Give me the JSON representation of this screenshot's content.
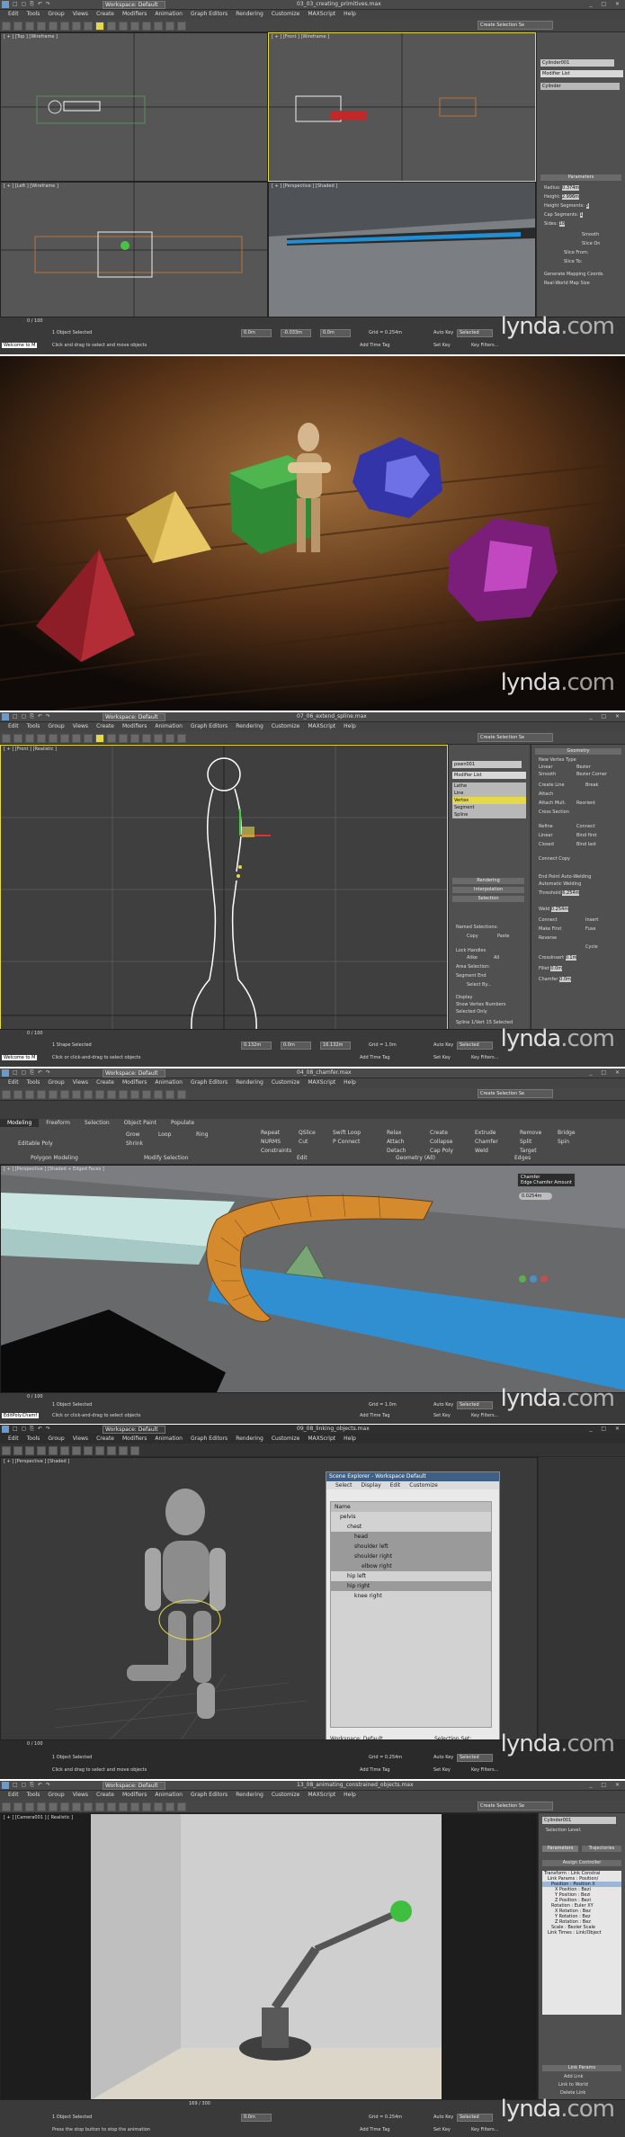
{
  "common": {
    "workspace": "Workspace: Default",
    "menus": [
      "Edit",
      "Tools",
      "Group",
      "Views",
      "Create",
      "Modifiers",
      "Animation",
      "Graph Editors",
      "Rendering",
      "Customize",
      "MAXScript",
      "Help"
    ],
    "selection_set": "Create Selection Se",
    "watermark_main": "lynda",
    "watermark_suffix": ".com",
    "auto_key": "Auto Key",
    "set_key": "Set Key",
    "key_filters": "Key Filters...",
    "selected": "Selected",
    "add_time_tag": "Add Time Tag"
  },
  "shot1": {
    "file": "03_03_creating_primitives.max",
    "viewports": {
      "top": "[ + ] [Top ] [Wireframe ]",
      "front": "[ + ] [Front ] [Wireframe ]",
      "left": "[ + ] [Left ] [Wireframe ]",
      "persp": "[ + ] [Perspective ] [Shaded ]"
    },
    "object_name": "Cylinder001",
    "modifier_list": "Modifier List",
    "stack_item": "Cylinder",
    "params_title": "Parameters",
    "params": [
      {
        "k": "Radius:",
        "v": "0.374m"
      },
      {
        "k": "Height:",
        "v": "2.996m"
      },
      {
        "k": "Height Segments:",
        "v": "5"
      },
      {
        "k": "Cap Segments:",
        "v": "1"
      },
      {
        "k": "Sides:",
        "v": "18"
      }
    ],
    "checks": [
      "Smooth",
      "Slice On",
      "Slice From:",
      "Slice To:",
      "Generate Mapping Coords.",
      "Real-World Map Size"
    ],
    "timeline": "0 / 100",
    "status_objects": "1 Object Selected",
    "status_prompt": "Click and drag to select and move objects",
    "welcome": "Welcome to M",
    "x": "0.0m",
    "y": "-0.033m",
    "z": "0.0m",
    "grid": "Grid = 0.254m"
  },
  "shot3": {
    "file": "07_06_extend_spline.max",
    "viewport": "[ + ] [Front ] [Realistic ]",
    "object_name": "pawn001",
    "modifier_list": "Modifier List",
    "stack": [
      "Lathe",
      "Line",
      "Vertex",
      "Segment",
      "Spline"
    ],
    "rollouts": [
      "Rendering",
      "Interpolation",
      "Selection",
      "Soft Selection",
      "Geometry"
    ],
    "named_selections": "Named Selections:",
    "copy": "Copy",
    "paste": "Paste",
    "lock_handles": "Lock Handles",
    "alike": "Alike",
    "all": "All",
    "area_selection": "Area Selection:",
    "segment_end": "Segment End",
    "select_by": "Select By...",
    "display": "Display",
    "show_vertex_numbers": "Show Vertex Numbers",
    "selected_only": "Selected Only",
    "spline_status": "Spline 1/Vert 15 Selected",
    "geometry": {
      "new_vertex_type": "New Vertex Type",
      "types": [
        "Linear",
        "Bezier",
        "Smooth",
        "Bezier Corner"
      ],
      "buttons": [
        "Create Line",
        "Break",
        "Attach",
        "Reorient",
        "Attach Mult.",
        "Cross Section",
        "Refine",
        "Connect",
        "Linear",
        "Bind first",
        "Closed",
        "Bind last",
        "Connect Copy",
        "End Point Auto-Welding",
        "Automatic Welding",
        "Threshold",
        "Weld",
        "Connect",
        "Insert",
        "Make First",
        "Fuse",
        "Reverse",
        "Cycle",
        "CrossInsert",
        "Fillet",
        "Chamfer"
      ],
      "threshold": "6.254m",
      "weld": "0.254m",
      "fillet": "0.0m",
      "chamfer": "0.0m",
      "crossinsert": "0.1m"
    },
    "timeline": "0 / 100",
    "status_objects": "1 Shape Selected",
    "status_prompt": "Click or click-and-drag to select objects",
    "welcome": "Welcome to M",
    "x": "0.132m",
    "y": "0.0m",
    "z": "16.132m",
    "grid": "Grid = 1.0m"
  },
  "shot4": {
    "file": "04_08_chamfer.max",
    "tabs": [
      "Modeling",
      "Freeform",
      "Selection",
      "Object Paint",
      "Populate"
    ],
    "groups": [
      "Polygon Modeling",
      "Modify Selection",
      "Edit",
      "Geometry (All)",
      "Edges"
    ],
    "buttons": [
      "Grow",
      "Shrink",
      "Loop",
      "Ring",
      "Repeat",
      "QSlice",
      "Swift Loop",
      "NURMS",
      "Cut",
      "P Connect",
      "Constraints",
      "Relax",
      "Create",
      "Extrude",
      "Remove",
      "Bridge",
      "Attach",
      "Collapse",
      "Chamfer",
      "Split",
      "Spin",
      "Detach",
      "Cap Poly",
      "Weld",
      "Target",
      "Editable Poly"
    ],
    "tooltip": [
      "Chamfer",
      "Edge Chamfer Amount"
    ],
    "caddy_value": "0.0254m",
    "viewport": "[ + ] [Perspective ] [Shaded + Edged Faces ]",
    "timeline": "0 / 100",
    "status_objects": "1 Object Selected",
    "status_prompt": "Click or click-and-drag to select objects",
    "welcome": "EditPoly.Chamf",
    "grid": "Grid = 1.0m"
  },
  "shot5": {
    "file": "09_08_linking_objects.max",
    "viewport": "[ + ] [Perspective ] [Shaded ]",
    "explorer_title": "Scene Explorer - Workspace Default",
    "explorer_menus": [
      "Select",
      "Display",
      "Edit",
      "Customize"
    ],
    "name_col": "Name",
    "items": [
      "pelvis",
      "chest",
      "head",
      "shoulder left",
      "shoulder right",
      "elbow right",
      "hip left",
      "hip right",
      "knee right"
    ],
    "footer": "Workspace: Default",
    "selection_set": "Selection Set:",
    "timeline": "0 / 100",
    "status_objects": "1 Object Selected",
    "status_prompt": "Click and drag to select and move objects",
    "grid": "Grid = 0.254m"
  },
  "shot6": {
    "file": "13_08_animating_constrained_objects.max",
    "viewport": "[ + ] [Camera001 ] [ Realistic ]",
    "object_name": "Cylinder001",
    "selection_level": "Selection Level:",
    "tabs": [
      "Parameters",
      "Trajectories"
    ],
    "assign_controller": "Assign Controller",
    "tree": [
      "Transform : Link Constrai",
      "Link Params : Position/",
      "Position : Position X",
      "X Position : Bezi",
      "Y Position : Bezi",
      "Z Position : Bezi",
      "Rotation : Euler XY",
      "X Rotation : Bez",
      "Y Rotation : Bez",
      "Z Rotation : Bez",
      "Scale : Bezier Scale",
      "Link Times : Link/Object"
    ],
    "link_params": "Link Params",
    "link_buttons": [
      "Add Link",
      "Link to World",
      "Delete Link"
    ],
    "timeline": "169 / 300",
    "status_objects": "1 Object Selected",
    "status_prompt": "Press the stop button to stop the animation",
    "grid": "Grid = 0.254m",
    "x": "0.0m"
  }
}
